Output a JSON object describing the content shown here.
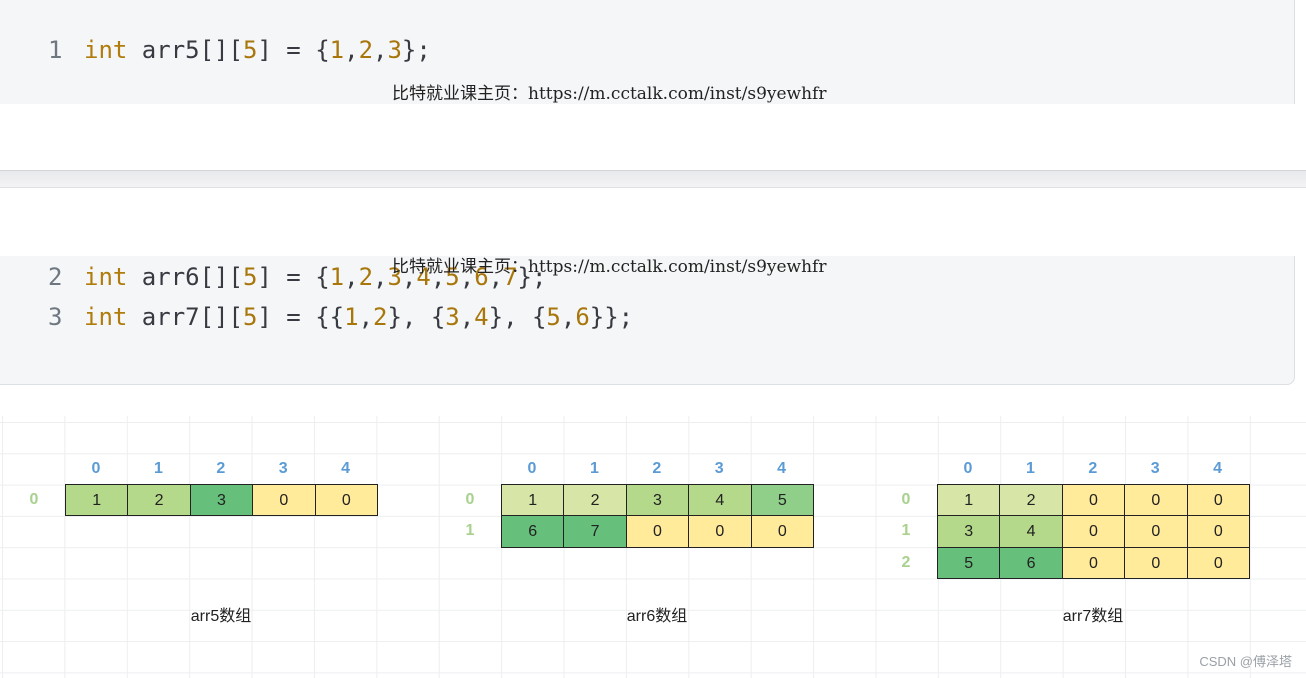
{
  "code_block_1": {
    "lines": [
      {
        "num": "1",
        "kw": "int",
        "rest_a": " arr5[][",
        "n5": "5",
        "rest_b": "] = {",
        "v1": "1",
        "c1": ",",
        "v2": "2",
        "c2": ",",
        "v3": "3",
        "end": "};"
      }
    ],
    "watermark": "比特就业课主页：https://m.cctalk.com/inst/s9yewhfr"
  },
  "code_block_2": {
    "watermark": "比特就业课主页：https://m.cctalk.com/inst/s9yewhfr",
    "line2": {
      "num": "2",
      "kw": "int",
      "a": " arr6[][",
      "b": "5",
      "c": "] = {",
      "d": "1",
      "e": ",",
      "f": "2",
      "g": ",",
      "h": "3",
      "i": ",",
      "j": "4",
      "k": ",",
      "l": "5",
      "m": ",",
      "n": "6",
      "o": ",",
      "p": "7",
      "q": "};"
    },
    "line3": {
      "num": "3",
      "kw": "int",
      "a": " arr7[][",
      "b": "5",
      "c": "] = {{",
      "d": "1",
      "e": ",",
      "f": "2",
      "g": "}, {",
      "h": "3",
      "i": ",",
      "j": "4",
      "k": "}, {",
      "l": "5",
      "m": ",",
      "n": "6",
      "o": "}};"
    }
  },
  "diagram": {
    "col_indices": [
      "0",
      "1",
      "2",
      "3",
      "4"
    ],
    "arr5": {
      "rows": [
        "0"
      ],
      "values": [
        [
          "1",
          "2",
          "3",
          "0",
          "0"
        ]
      ],
      "caption": "arr5数组"
    },
    "arr6": {
      "rows": [
        "0",
        "1"
      ],
      "values": [
        [
          "1",
          "2",
          "3",
          "4",
          "5"
        ],
        [
          "6",
          "7",
          "0",
          "0",
          "0"
        ]
      ],
      "caption": "arr6数组"
    },
    "arr7": {
      "rows": [
        "0",
        "1",
        "2"
      ],
      "values": [
        [
          "1",
          "2",
          "0",
          "0",
          "0"
        ],
        [
          "3",
          "4",
          "0",
          "0",
          "0"
        ],
        [
          "5",
          "6",
          "0",
          "0",
          "0"
        ]
      ],
      "caption": "arr7数组"
    },
    "colors": {
      "light_green": "#d7e5a6",
      "mid_green": "#b4d98b",
      "green": "#8fcf8a",
      "dark_green": "#66bf7a",
      "yellow": "#ffeb99"
    }
  },
  "credit": "CSDN @傅泽塔"
}
